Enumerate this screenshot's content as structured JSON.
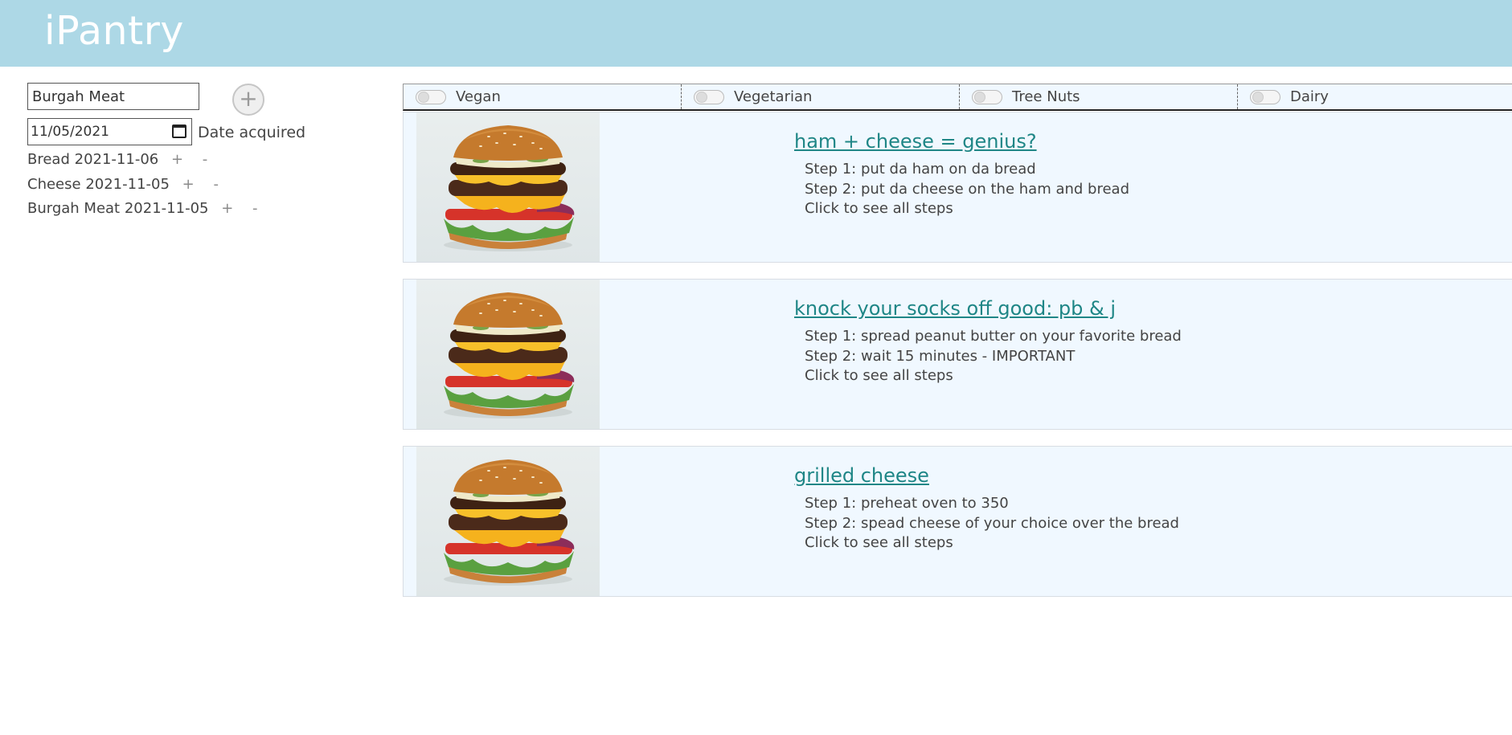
{
  "app": {
    "title": "iPantry"
  },
  "pantry_form": {
    "item_value": "Burgah Meat",
    "add_label": "+",
    "date_value": "11/05/2021",
    "date_label": "Date acquired"
  },
  "pantry_items": [
    {
      "name": "Bread",
      "date": "2021-11-06"
    },
    {
      "name": "Cheese",
      "date": "2021-11-05"
    },
    {
      "name": "Burgah Meat",
      "date": "2021-11-05"
    }
  ],
  "pantry_controls": {
    "plus": "+",
    "minus": "-"
  },
  "filters": [
    {
      "label": "Vegan",
      "enabled": false
    },
    {
      "label": "Vegetarian",
      "enabled": false
    },
    {
      "label": "Tree Nuts",
      "enabled": false
    },
    {
      "label": "Dairy",
      "enabled": false
    }
  ],
  "recipes": [
    {
      "title": "ham + cheese = genius?",
      "step1": "Step 1: put da ham on da bread",
      "step2": "Step 2: put da cheese on the ham and bread",
      "see_all": "Click to see all steps"
    },
    {
      "title": "knock your socks off good: pb & j",
      "step1": "Step 1: spread peanut butter on your favorite bread",
      "step2": "Step 2: wait 15 minutes - IMPORTANT",
      "see_all": "Click to see all steps"
    },
    {
      "title": "grilled cheese",
      "step1": "Step 1: preheat oven to 350",
      "step2": "Step 2: spead cheese of your choice over the bread",
      "see_all": "Click to see all steps"
    }
  ],
  "colors": {
    "header": "#add8e6",
    "card_bg": "#f0f8ff",
    "link": "#1f8686"
  }
}
